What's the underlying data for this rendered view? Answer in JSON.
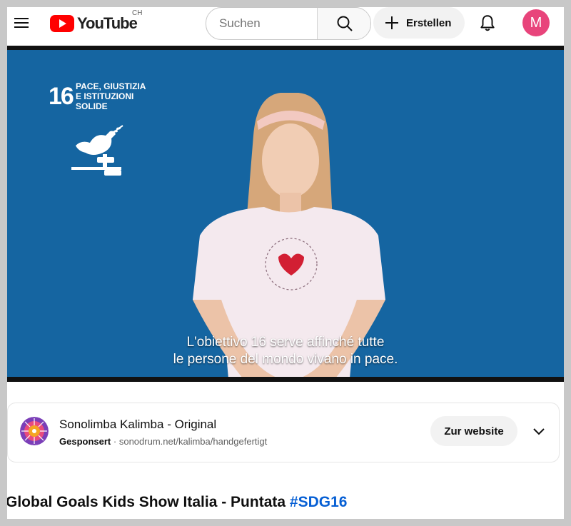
{
  "header": {
    "logo_text": "YouTube",
    "region": "CH",
    "search_placeholder": "Suchen",
    "create_label": "Erstellen",
    "avatar_initial": "M",
    "avatar_color": "#e8447b",
    "brand_color": "#ff0000",
    "icons": [
      "menu-icon",
      "search-icon",
      "plus-icon",
      "bell-icon"
    ]
  },
  "video": {
    "sdg_number": "16",
    "sdg_title": "PACE, GIUSTIZIA E ISTITUZIONI SOLIDE",
    "subtitle_line1": "L'obiettivo 16 serve affinché tutte",
    "subtitle_line2": "le persone del mondo vivano in pace.",
    "background_color": "#1565a1"
  },
  "ad": {
    "title": "Sonolimba Kalimba - Original",
    "sponsored": "Gesponsert",
    "separator": "·",
    "url": "sonodrum.net/kalimba/handgefertigt",
    "cta": "Zur website"
  },
  "title": {
    "text": "Global Goals Kids Show Italia - Puntata ",
    "hashtag": "#SDG16",
    "hashtag_color": "#065fd4"
  }
}
